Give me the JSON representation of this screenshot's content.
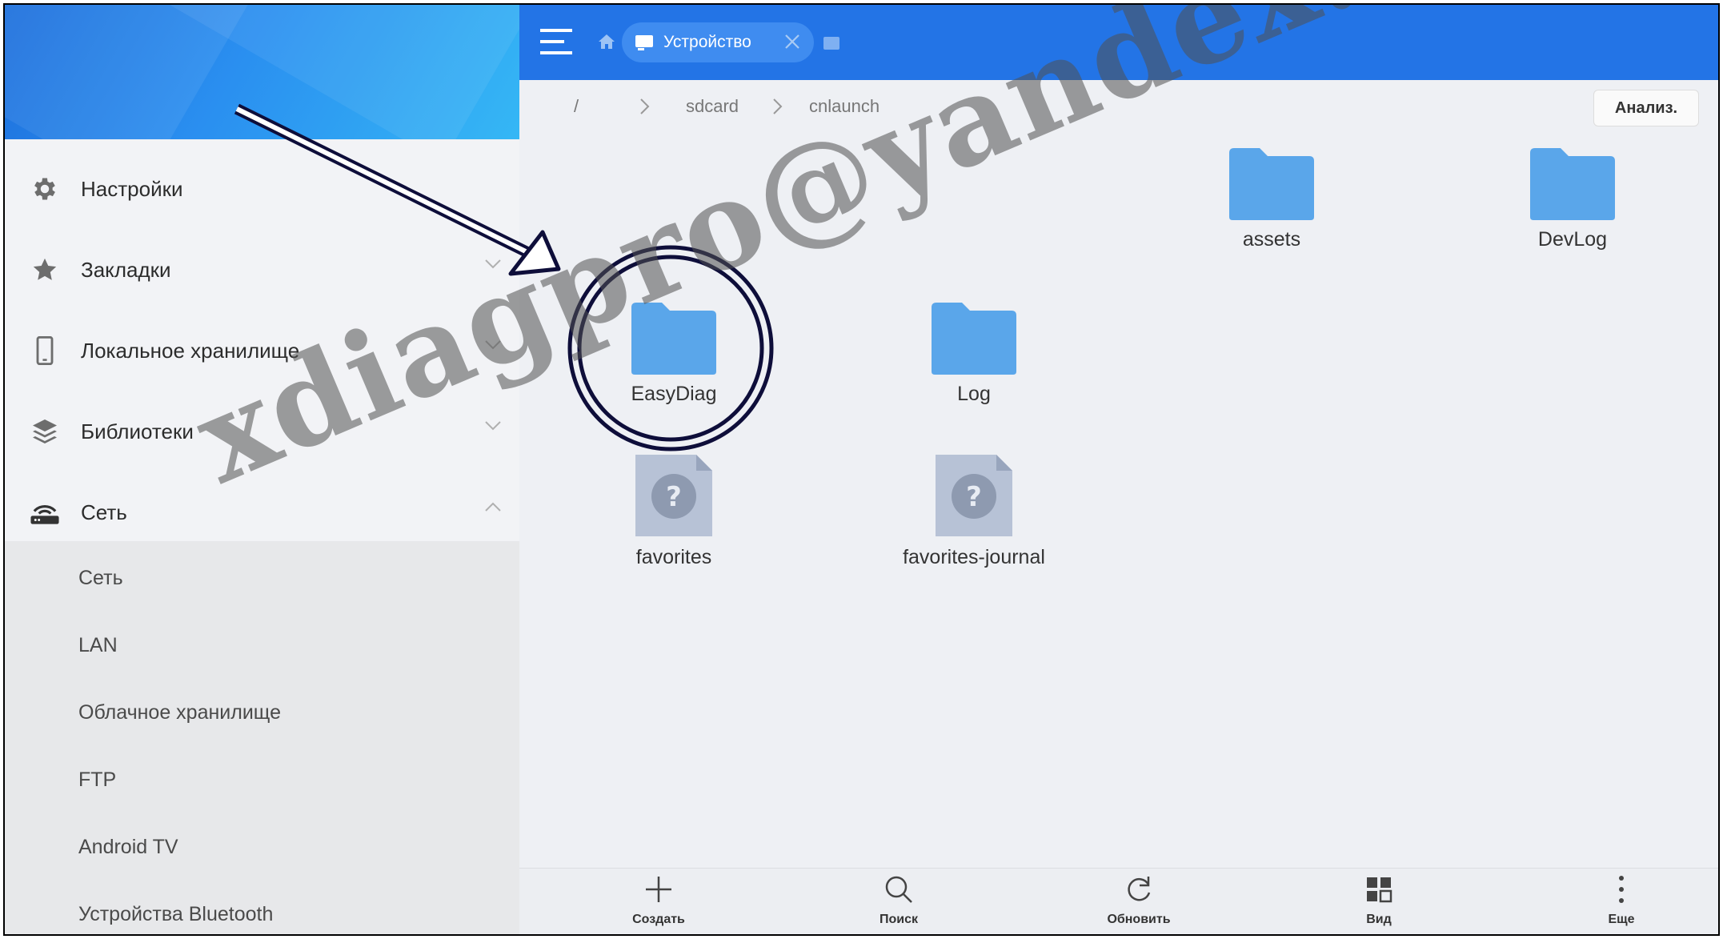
{
  "sidebar": {
    "items": [
      {
        "label": "Настройки",
        "icon": "gear-icon"
      },
      {
        "label": "Закладки",
        "icon": "star-icon"
      },
      {
        "label": "Локальное хранилище",
        "icon": "phone-icon"
      },
      {
        "label": "Библиотеки",
        "icon": "layers-icon"
      },
      {
        "label": "Сеть",
        "icon": "router-icon"
      }
    ],
    "network_sub_items": [
      "Сеть",
      "LAN",
      "Облачное хранилище",
      "FTP",
      "Android TV",
      "Устройства Bluetooth"
    ]
  },
  "topbar": {
    "tab_label": "Устройство"
  },
  "path": {
    "root": "/",
    "segments": [
      "sdcard",
      "cnlaunch"
    ],
    "analyze_label": "Анализ."
  },
  "files": [
    {
      "name": "assets",
      "type": "folder"
    },
    {
      "name": "DevLog",
      "type": "folder"
    },
    {
      "name": "EasyDiag",
      "type": "folder"
    },
    {
      "name": "Log",
      "type": "folder"
    },
    {
      "name": "favorites",
      "type": "unknown-file"
    },
    {
      "name": "favorites-journal",
      "type": "unknown-file"
    }
  ],
  "bottombar": {
    "create": "Создать",
    "search": "Поиск",
    "refresh": "Обновить",
    "view": "Вид",
    "more": "Еще"
  },
  "watermark": "xdiagpro@yandex.ru",
  "colors": {
    "topbar": "#2374e6",
    "folder": "#5aa6ea",
    "annotation": "#0e0e3a"
  }
}
